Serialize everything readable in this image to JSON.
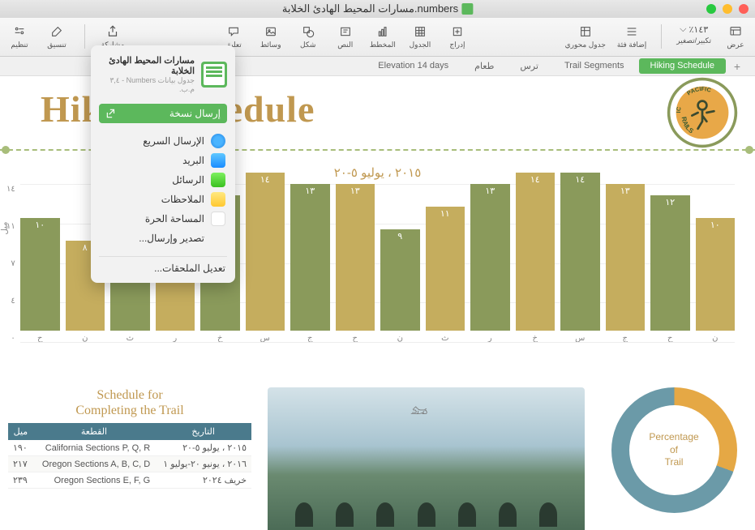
{
  "window": {
    "title": "مسارات المحيط الهادئ الخلابة.numbers"
  },
  "toolbar": {
    "view": "عرض",
    "zoom": "تكبير/تصغير",
    "zoom_value": "١٤٣٪",
    "add_category": "إضافة فئة",
    "pivot": "جدول محوري",
    "insert": "إدراج",
    "table": "الجدول",
    "chart": "المخطط",
    "text": "النص",
    "shape": "شكل",
    "media": "وسائط",
    "comment": "تعليق",
    "share": "مشاركة",
    "format": "تنسيق",
    "organize": "تنظيم"
  },
  "tabs": [
    {
      "label": "Hiking Schedule",
      "active": true
    },
    {
      "label": "Trail Segments",
      "active": false
    },
    {
      "label": "ترس",
      "active": false
    },
    {
      "label": "طعام",
      "active": false
    },
    {
      "label": "Elevation 14 days",
      "active": false
    }
  ],
  "document": {
    "title": "Hiking Schedule",
    "logo_top": "SCENIC",
    "logo_right": "PACIFIC",
    "logo_bottom": "TRAILS"
  },
  "popover": {
    "doc_title": "مسارات المحيط الهادئ الخلابة",
    "doc_subtitle": "جدول بيانات Numbers - ٣,٤ م.ب.",
    "send_copy": "إرسال نسخة",
    "items": [
      {
        "label": "الإرسال السريع",
        "icon": "airdrop"
      },
      {
        "label": "البريد",
        "icon": "mail"
      },
      {
        "label": "الرسائل",
        "icon": "messages"
      },
      {
        "label": "الملاحظات",
        "icon": "notes"
      },
      {
        "label": "المساحة الحرة",
        "icon": "freeform"
      },
      {
        "label": "تصدير وإرسال...",
        "icon": ""
      }
    ],
    "edit_extensions": "تعديل الملحقات..."
  },
  "chart_data": {
    "type": "bar",
    "title": "٢٠١٥ ، يوليو ٥-٢٠",
    "ylabel": "ميل",
    "ylim": [
      0,
      14
    ],
    "yticks": [
      "٠",
      "٤",
      "٧",
      "١١",
      "١٤"
    ],
    "categories": [
      "ن",
      "ح",
      "ج",
      "س",
      "خ",
      "ر",
      "ث",
      "ن",
      "ح",
      "ج",
      "س",
      "خ",
      "ر",
      "ث",
      "ن",
      "ح"
    ],
    "values": [
      10,
      12,
      13,
      14,
      14,
      13,
      11,
      9,
      13,
      13,
      14,
      12,
      11,
      12,
      8,
      10
    ],
    "value_labels": [
      "١٠",
      "١٢",
      "١٣",
      "١٤",
      "١٤",
      "١٣",
      "١١",
      "٩",
      "١٣",
      "١٣",
      "١٤",
      "١٢",
      "١١",
      "١٢",
      "٨",
      "١٠"
    ]
  },
  "schedule": {
    "title": "Schedule for\nCompleting the Trail",
    "headers": {
      "date": "التاريخ",
      "segment": "القطعة",
      "miles": "ميل"
    },
    "rows": [
      {
        "date": "٢٠١٥ ، يوليو ٥-٢٠",
        "segment": "California Sections P, Q, R",
        "miles": "١٩٠"
      },
      {
        "date": "٢٠١٦ ، يونيو ٢٠-يوليو ١",
        "segment": "Oregon Sections A, B, C, D",
        "miles": "٢١٧"
      },
      {
        "date": "خريف ٢٠٢٤",
        "segment": "Oregon Sections E, F, G",
        "miles": "٢٣٩"
      }
    ]
  },
  "pie": {
    "title": "Percentage\nof\nTrail"
  }
}
